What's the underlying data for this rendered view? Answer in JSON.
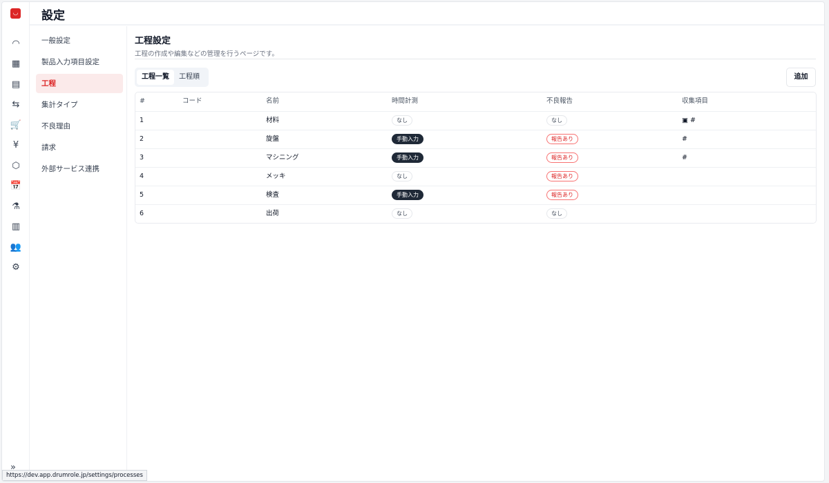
{
  "header": {
    "title": "設定"
  },
  "rail": {
    "icons": [
      "dashboard-icon",
      "table-icon",
      "calculator-icon",
      "transfer-icon",
      "cart-icon",
      "yen-icon",
      "package-icon",
      "calendar-icon",
      "microscope-icon",
      "building-icon",
      "users-icon",
      "gear-icon"
    ],
    "glyphs": [
      "◠",
      "▦",
      "▤",
      "⇆",
      "🛒",
      "¥",
      "⬡",
      "📅",
      "⚗",
      "▥",
      "👥",
      "⚙"
    ],
    "expand": "»"
  },
  "submenu": [
    {
      "label": "一般設定"
    },
    {
      "label": "製品入力項目設定"
    },
    {
      "label": "工程",
      "active": true
    },
    {
      "label": "集計タイプ"
    },
    {
      "label": "不良理由"
    },
    {
      "label": "請求"
    },
    {
      "label": "外部サービス連携"
    }
  ],
  "main": {
    "title": "工程設定",
    "description": "工程の作成や編集などの管理を行うページです。",
    "tabs": [
      "工程一覧",
      "工程順"
    ],
    "add_label": "追加"
  },
  "table": {
    "headers": [
      "#",
      "コード",
      "名前",
      "時間計測",
      "不良報告",
      "収集項目"
    ],
    "rows": [
      {
        "num": "1",
        "code": "",
        "name": "材料",
        "time": "なし",
        "defect": "なし",
        "items": "▣ #"
      },
      {
        "num": "2",
        "code": "",
        "name": "旋盤",
        "time": "手動入力",
        "defect": "報告あり",
        "items": "#"
      },
      {
        "num": "3",
        "code": "",
        "name": "マシニング",
        "time": "手動入力",
        "defect": "報告あり",
        "items": "#"
      },
      {
        "num": "4",
        "code": "",
        "name": "メッキ",
        "time": "なし",
        "defect": "報告あり",
        "items": ""
      },
      {
        "num": "5",
        "code": "",
        "name": "検査",
        "time": "手動入力",
        "defect": "報告あり",
        "items": ""
      },
      {
        "num": "6",
        "code": "",
        "name": "出荷",
        "time": "なし",
        "defect": "なし",
        "items": ""
      }
    ]
  },
  "status_url": "https://dev.app.drumrole.jp/settings/processes"
}
